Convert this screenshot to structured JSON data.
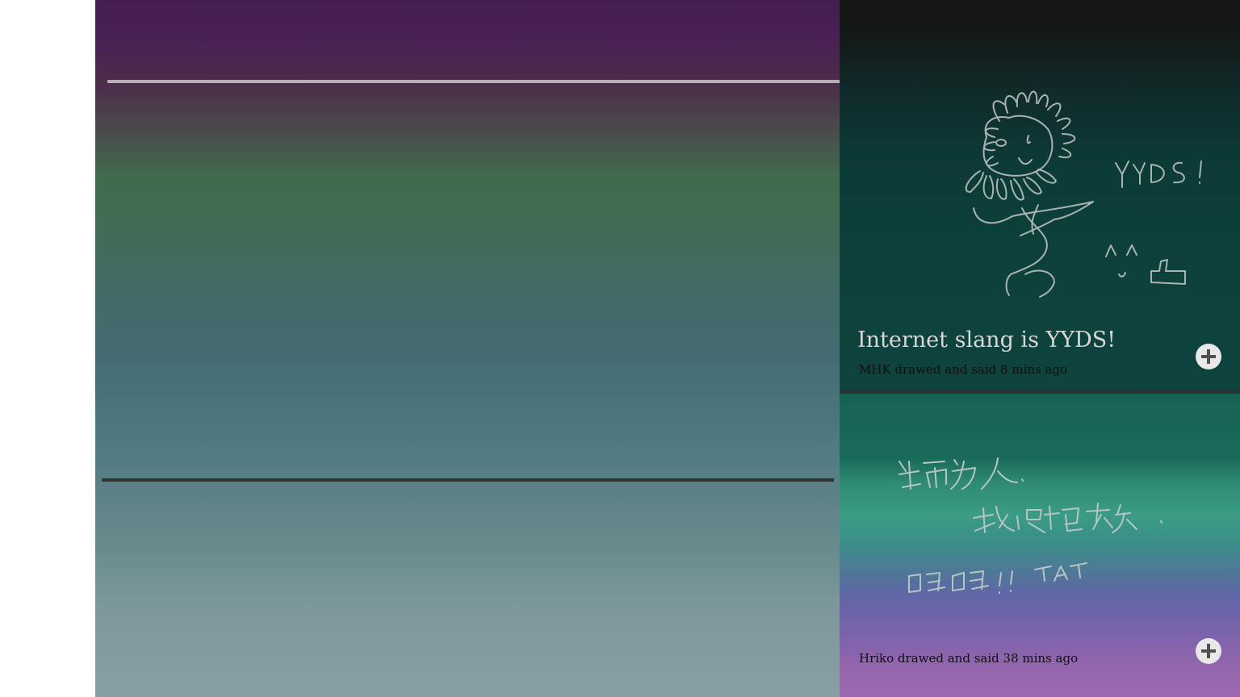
{
  "posts": [
    {
      "title": "Internet slang is YYDS!",
      "meta": "MHK drawed and said 8 mins ago",
      "drawing": "sunflower-smiley sketch",
      "drawing_text": [
        "YYDS!",
        "^^",
        "👍"
      ],
      "add_icon": "plus-circle-icon"
    },
    {
      "title": "",
      "meta": "Hriko drawed and said 38 mins ago",
      "drawing": "handwritten note",
      "drawing_text": [
        "生而为人，",
        "我很抱歉。",
        "呜呜!! TAT"
      ],
      "add_icon": "plus-circle-icon"
    }
  ],
  "colors": {
    "canvas_top": "#441d54",
    "canvas_mid": "#436a64",
    "canvas_bottom": "#88a0a3",
    "card1_bg": "#0d403b",
    "card2_bg_top": "#176254",
    "card2_bg_bottom": "#9b69b1",
    "sketch_stroke": "#a9b3b0"
  }
}
